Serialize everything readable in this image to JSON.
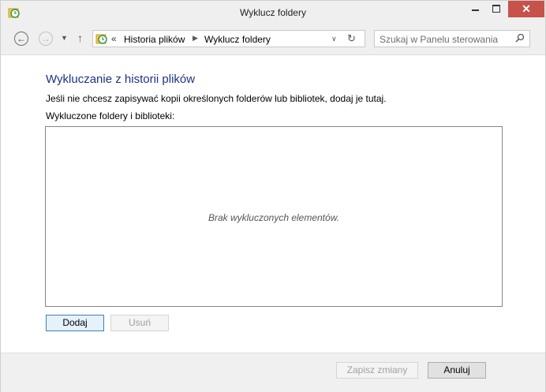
{
  "window": {
    "title": "Wyklucz foldery",
    "close_glyph": "✕",
    "title_icon": "file-history-icon"
  },
  "nav": {
    "back_glyph": "←",
    "forward_glyph": "→",
    "recent_glyph": "▼",
    "up_glyph": "↑",
    "address": {
      "chevron": "«",
      "crumbs": [
        "Historia plików",
        "Wyklucz foldery"
      ],
      "separator_glyph": "▶",
      "dropdown_glyph": "∨",
      "refresh_glyph": "↻"
    },
    "search": {
      "placeholder": "Szukaj w Panelu sterowania"
    }
  },
  "content": {
    "heading": "Wykluczanie z historii plików",
    "description": "Jeśli nie chcesz zapisywać kopii określonych folderów lub bibliotek, dodaj je tutaj.",
    "list_label": "Wykluczone foldery i biblioteki:",
    "empty_text": "Brak wykluczonych elementów.",
    "add_label": "Dodaj",
    "remove_label": "Usuń"
  },
  "footer": {
    "save_label": "Zapisz zmiany",
    "cancel_label": "Anuluj"
  },
  "colors": {
    "heading": "#1e3287",
    "close_button": "#c7514b",
    "focus_border": "#3c7fb1"
  }
}
